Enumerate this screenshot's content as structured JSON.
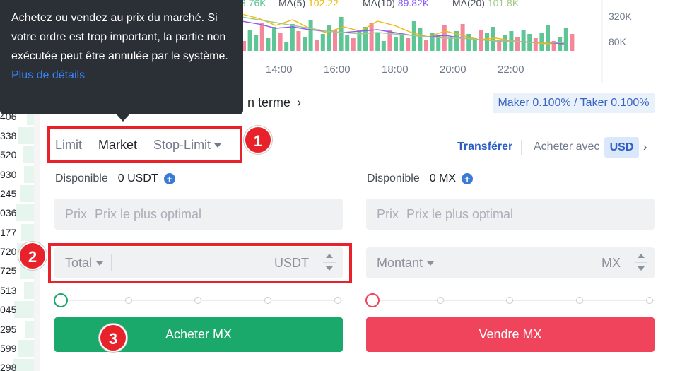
{
  "order_book": {
    "prices": [
      "406",
      "338",
      "520",
      "930",
      "245",
      "036",
      "177",
      "720",
      "725",
      "513",
      "045",
      "295",
      "599",
      "298"
    ]
  },
  "chart": {
    "ma_legend": {
      "vol_value": "3.76K",
      "ma5_label": "MA(5)",
      "ma5_value": "102.22",
      "ma10_label": "MA(10)",
      "ma10_value": "89.82K",
      "ma20_label": "MA(20)",
      "ma20_value": "101.8K"
    },
    "time_labels": [
      "14:00",
      "16:00",
      "18:00",
      "20:00",
      "22:00"
    ],
    "volume_axis": [
      "320K",
      "80K"
    ],
    "colors": {
      "up": "#5ec595",
      "down": "#f4889a",
      "ma5": "#f0b90b",
      "ma10": "#8a5cf6",
      "ma20": "#a3c98a"
    }
  },
  "tooltip": {
    "text": "Achetez ou vendez au prix du marché. Si votre ordre est trop important, la partie non exécutée peut être annulée par le système.",
    "link": "Plus de détails"
  },
  "header": {
    "terme": "n terme",
    "fees": "Maker 0.100% / Taker 0.100%"
  },
  "order_tabs": {
    "limit": "Limit",
    "market": "Market",
    "stop_limit": "Stop-Limit"
  },
  "toolbar": {
    "transfer": "Transférer",
    "buy_with": "Acheter avec",
    "currency": "USD"
  },
  "buy_panel": {
    "available_label": "Disponible",
    "available_value": "0 USDT",
    "price_label": "Prix",
    "price_placeholder": "Prix le plus optimal",
    "total_label": "Total",
    "total_unit": "USDT",
    "slider_percent": 0,
    "button": "Acheter MX"
  },
  "sell_panel": {
    "available_label": "Disponible",
    "available_value": "0 MX",
    "price_label": "Prix",
    "price_placeholder": "Prix le plus optimal",
    "amount_label": "Montant",
    "amount_unit": "MX",
    "slider_percent": 0,
    "button": "Vendre MX"
  },
  "annotations": [
    "1",
    "2",
    "3"
  ],
  "annotation_color": "#e8222a"
}
